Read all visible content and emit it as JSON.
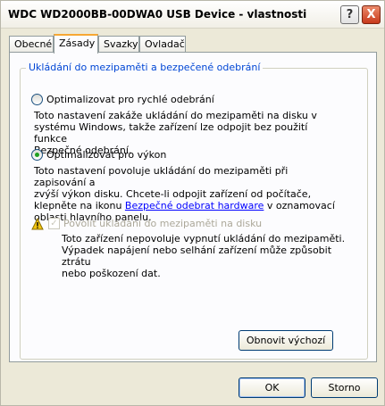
{
  "window": {
    "title": "WDC WD2000BB-00DWA0 USB Device - vlastnosti"
  },
  "title_buttons": {
    "help": "?",
    "close": "X"
  },
  "tabs": [
    {
      "label": "Obecné"
    },
    {
      "label": "Zásady"
    },
    {
      "label": "Svazky"
    },
    {
      "label": "Ovladač"
    }
  ],
  "group": {
    "title": "Ukládání do mezipaměti a bezpečené odebrání"
  },
  "option_quick": {
    "label": "Optimalizovat pro rychlé odebrání",
    "selected": false,
    "desc_lines": [
      "Toto nastavení zakáže ukládání do mezipaměti na disku v",
      "systému Windows, takže zařízení lze odpojit bez použití funkce",
      "Bezpečné odebrání."
    ]
  },
  "option_perf": {
    "label": "Optimalizovat pro výkon",
    "selected": true,
    "desc_line1": "Toto nastavení povoluje ukládání do mezipaměti při zapisování a",
    "desc_line2": "zvýší výkon disku. Chcete-li odpojit zařízení od počítače,",
    "desc_line3_pre": "klepněte na ikonu ",
    "desc_link": "Bezpečné odebrat hardware",
    "desc_line3_post": " v oznamovací",
    "desc_line4": "oblasti hlavního panelu."
  },
  "cache_checkbox": {
    "label": "Povolit ukládání do mezipaměti na disku",
    "checked": true,
    "enabled": false,
    "desc_lines": [
      "Toto zařízení nepovoluje vypnutí ukládání do mezipaměti.",
      "Výpadek napájení nebo selhání zařízení může způsobit ztrátu",
      "nebo poškození dat."
    ]
  },
  "buttons": {
    "restore_default": "Obnovit výchozí",
    "ok": "OK",
    "cancel": "Storno"
  },
  "colors": {
    "accent": "#0046d5",
    "tab_highlight": "#f7a733",
    "link": "#0000ff",
    "warning": "#f2c40f"
  }
}
